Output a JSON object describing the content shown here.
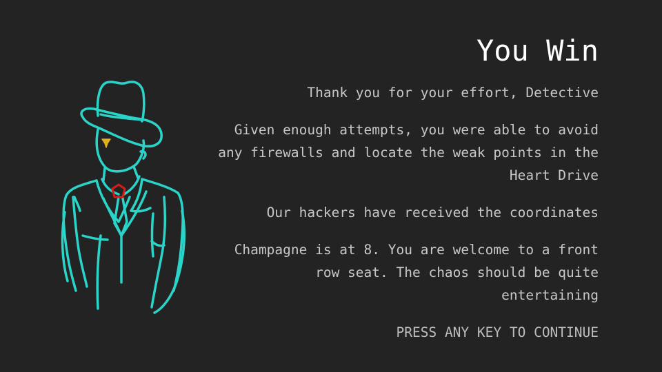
{
  "screen": {
    "title": "You Win",
    "paragraphs": [
      "Thank you for your effort, Detective",
      "Given enough attempts, you were able to avoid any firewalls and locate the weak points in the Heart Drive",
      "Our hackers have received the coordinates",
      "Champagne is at 8. You are welcome to a front row seat. The chaos should be quite entertaining"
    ],
    "continue_prompt": "PRESS ANY KEY TO CONTINUE"
  },
  "figure": {
    "icon": "detective-silhouette-icon",
    "outline_color": "#2ad4c8",
    "gem_color": "#d81c1c",
    "eye_color": "#e0b020"
  },
  "colors": {
    "background": "#232323",
    "title": "#ffffff",
    "body_text": "#c8c8c8"
  }
}
